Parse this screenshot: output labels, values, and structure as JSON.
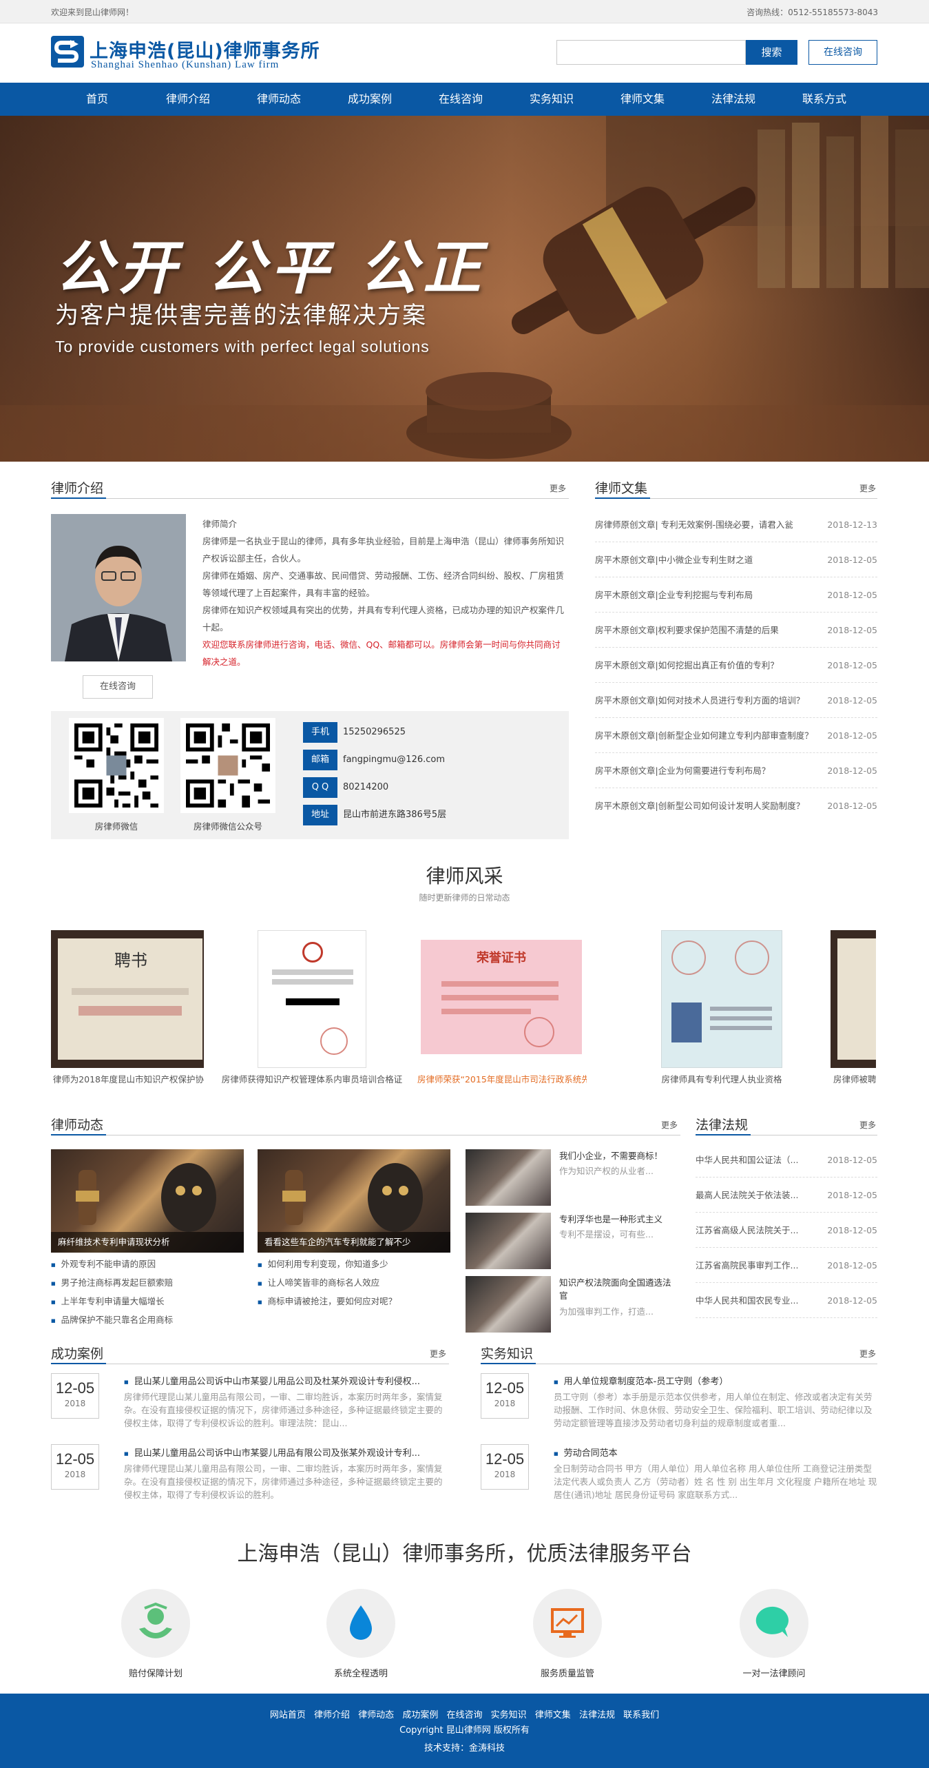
{
  "topbar": {
    "welcome": "欢迎来到昆山律师网！",
    "hotline": "咨询热线：0512-55185573-8043"
  },
  "header": {
    "logo_cn": "上海申浩(昆山)律师事务所",
    "logo_en": "Shanghai Shenhao (Kunshan) Law firm",
    "search_placeholder": "",
    "search_button": "搜索",
    "consult_button": "在线咨询"
  },
  "nav": {
    "items": [
      "首页",
      "律师介绍",
      "律师动态",
      "成功案例",
      "在线咨询",
      "实务知识",
      "律师文集",
      "法律法规",
      "联系方式"
    ]
  },
  "banner": {
    "slogan": "公开 公平 公正",
    "sub_cn": "为客户提供害完善的法律解决方案",
    "sub_en": "To provide customers with perfect legal solutions"
  },
  "intro": {
    "title": "律师介绍",
    "more": "更多",
    "heading": "律师简介",
    "p1": "房律师是一名执业于昆山的律师，具有多年执业经验，目前是上海申浩（昆山）律师事务所知识产权诉讼部主任，合伙人。",
    "p2": "房律师在婚姻、房产、交通事故、民间借贷、劳动报酬、工伤、经济合同纠纷、股权、厂房租赁等领域代理了上百起案件，具有丰富的经验。",
    "p3": "房律师在知识产权领域具有突出的优势，并具有专利代理人资格，已成功办理的知识产权案件几十起。",
    "red": "欢迎您联系房律师进行咨询，电话、微信、QQ、邮箱都可以。房律师会第一时间与你共同商讨解决之道。",
    "button": "在线咨询"
  },
  "contact": {
    "qr1_label": "房律师微信",
    "qr2_label": "房律师微信公众号",
    "items": [
      {
        "tag": "手机",
        "value": "15250296525"
      },
      {
        "tag": "邮箱",
        "value": "fangpingmu@126.com"
      },
      {
        "tag": "Q Q",
        "value": "80214200"
      },
      {
        "tag": "地址",
        "value": "昆山市前进东路386号5层"
      }
    ]
  },
  "articles": {
    "title": "律师文集",
    "more": "更多",
    "items": [
      {
        "t": "房律师原创文章| 专利无效案例-围绕必要，请君入瓮",
        "d": "2018-12-13"
      },
      {
        "t": "房平木原创文章|中小微企业专利生财之道",
        "d": "2018-12-05"
      },
      {
        "t": "房平木原创文章|企业专利挖掘与专利布局",
        "d": "2018-12-05"
      },
      {
        "t": "房平木原创文章|权利要求保护范围不清楚的后果",
        "d": "2018-12-05"
      },
      {
        "t": "房平木原创文章|如何挖掘出真正有价值的专利？",
        "d": "2018-12-05"
      },
      {
        "t": "房平木原创文章|如何对技术人员进行专利方面的培训？",
        "d": "2018-12-05"
      },
      {
        "t": "房平木原创文章|创新型企业如何建立专利内部审查制度？",
        "d": "2018-12-05"
      },
      {
        "t": "房平木原创文章|企业为何需要进行专利布局？",
        "d": "2018-12-05"
      },
      {
        "t": "房平木原创文章|创新型公司如何设计发明人奖励制度？",
        "d": "2018-12-05"
      }
    ]
  },
  "style": {
    "title": "律师风采",
    "subtitle": "随时更新律师的日常动态",
    "captions": [
      "律师为2018年度昆山市知识产权保护协",
      "房律师获得知识产权管理体系内审员培训合格证",
      "房律师荣获“2015年度昆山市司法行政系统先进",
      "房律师具有专利代理人执业资格",
      "房律师被聘"
    ],
    "cert_text": [
      "聘书",
      "荣誉证书"
    ]
  },
  "dynamics": {
    "title": "律师动态",
    "more": "更多",
    "feature1": {
      "cap": "麻纤维技术专利申请现状分析",
      "bullets": [
        "外观专利不能申请的原因",
        "男子抢注商标再发起巨额索赔",
        "上半年专利申请量大幅增长",
        "品牌保护不能只靠名企用商标"
      ]
    },
    "feature2": {
      "cap": "看看这些车企的汽车专利就能了解不少",
      "bullets": [
        "如何利用专利变现，你知道多少",
        "让人啼笑皆非的商标名人效应",
        "商标申请被抢注，要如何应对呢？"
      ]
    },
    "thumbs": [
      {
        "t": "我们小企业，不需要商标！",
        "s": "作为知识产权的从业者..."
      },
      {
        "t": "专利浮华也是一种形式主义",
        "s": "专利不是摆设，可有些..."
      },
      {
        "t": "知识产权法院面向全国遴选法官",
        "s": "为加强审判工作，打造..."
      }
    ]
  },
  "laws": {
    "title": "法律法规",
    "more": "更多",
    "items": [
      {
        "t": "中华人民共和国公证法（...",
        "d": "2018-12-05"
      },
      {
        "t": "最高人民法院关于依法装...",
        "d": "2018-12-05"
      },
      {
        "t": "江苏省高级人民法院关于...",
        "d": "2018-12-05"
      },
      {
        "t": "江苏省高院民事审判工作...",
        "d": "2018-12-05"
      },
      {
        "t": "中华人民共和国农民专业...",
        "d": "2018-12-05"
      }
    ]
  },
  "cases": {
    "title": "成功案例",
    "more": "更多",
    "items": [
      {
        "md": "12-05",
        "y": "2018",
        "t": "昆山某儿童用品公司诉中山市某婴儿用品公司及杜某外观设计专利侵权...",
        "d": "房律师代理昆山某儿童用品有限公司，一审、二审均胜诉，本案历时两年多，案情复杂。在没有直接侵权证据的情况下，房律师通过多种途径，多种证据最终锁定主要的侵权主体，取得了专利侵权诉讼的胜利。审理法院：昆山..."
      },
      {
        "md": "12-05",
        "y": "2018",
        "t": "昆山某儿童用品公司诉中山市某婴儿用品有限公司及张某外观设计专利...",
        "d": "房律师代理昆山某儿童用品有限公司，一审、二审均胜诉，本案历时两年多，案情复杂。在没有直接侵权证据的情况下，房律师通过多种途径，多种证据最终锁定主要的侵权主体，取得了专利侵权诉讼的胜利。"
      }
    ]
  },
  "knowledge": {
    "title": "实务知识",
    "more": "更多",
    "items": [
      {
        "md": "12-05",
        "y": "2018",
        "t": "用人单位规章制度范本-员工守则（参考）",
        "d": "员工守则（参考）本手册是示范本仅供参考，用人单位在制定、修改或者决定有关劳动报酬、工作时间、休息休假、劳动安全卫生、保险福利、职工培训、劳动纪律以及劳动定额管理等直接涉及劳动者切身利益的规章制度或者重..."
      },
      {
        "md": "12-05",
        "y": "2018",
        "t": "劳动合同范本",
        "d": "全日制劳动合同书 甲方（用人单位）用人单位名称 用人单位住所 工商登记注册类型 法定代表人或负责人 乙方（劳动者）姓 名 性 别 出生年月 文化程度 户籍所在地址 现居住(通讯)地址 居民身份证号码 家庭联系方式..."
      }
    ]
  },
  "platform": {
    "title": "上海申浩（昆山）律师事务所，优质法律服务平台",
    "features": [
      "赔付保障计划",
      "系统全程透明",
      "服务质量监管",
      "一对一法律顾问"
    ]
  },
  "footer": {
    "links": [
      "网站首页",
      "律师介绍",
      "律师动态",
      "成功案例",
      "在线咨询",
      "实务知识",
      "律师文集",
      "法律法规",
      "联系我们"
    ],
    "copyright": "Copyright 昆山律师网 版权所有",
    "tech": "技术支持：金涛科技"
  },
  "colors": {
    "brand": "#0a58a4",
    "accent": "#e36b22",
    "alert": "#d6232b"
  }
}
